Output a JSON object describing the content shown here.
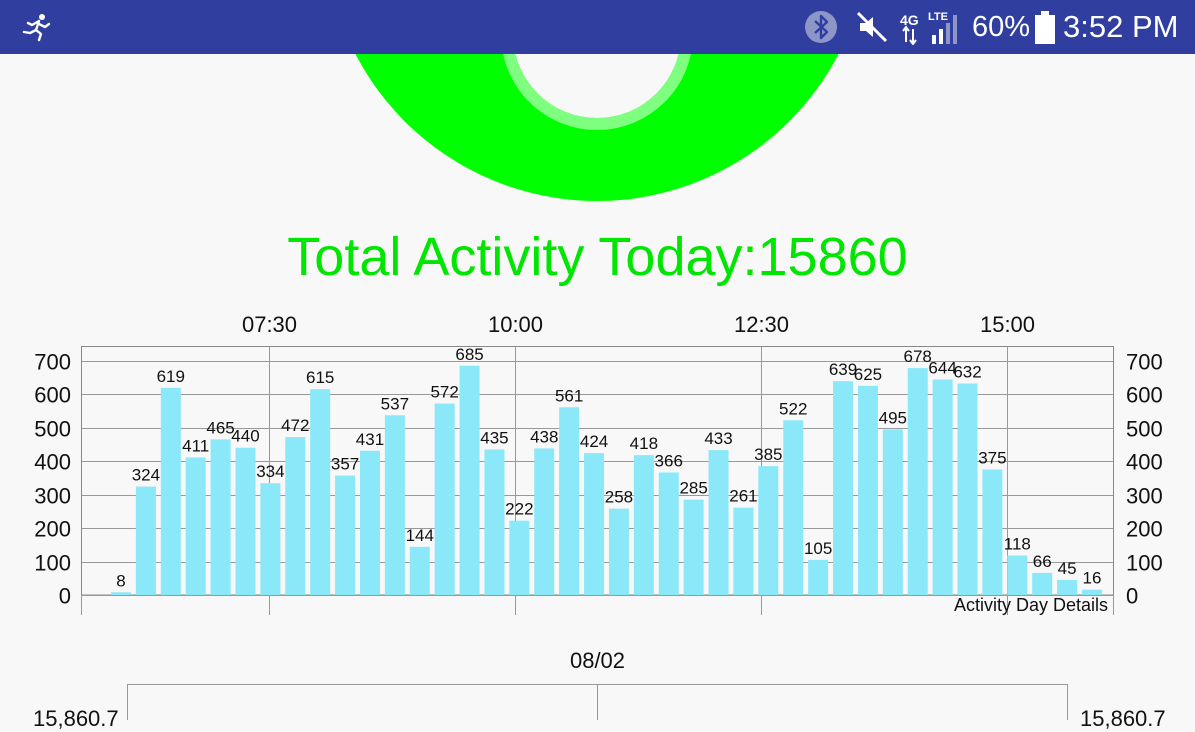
{
  "status_bar": {
    "battery_percent": "60%",
    "time": "3:52 PM",
    "network_label": "4G",
    "network_sub": "LTE",
    "colors": {
      "bar": "#303f9f"
    },
    "icons": [
      "running-person-icon",
      "bluetooth-icon",
      "mute-icon",
      "signal-icon",
      "battery-icon"
    ]
  },
  "activity_ring": {
    "color": "#00ff00"
  },
  "total_activity": {
    "label": "Total Activity Today:15860",
    "color": "#00e600"
  },
  "chart_data": {
    "type": "bar",
    "bar_color": "#8be8f8",
    "values": [
      8,
      324,
      619,
      411,
      465,
      440,
      334,
      472,
      615,
      357,
      431,
      537,
      144,
      572,
      685,
      435,
      222,
      438,
      561,
      424,
      258,
      418,
      366,
      285,
      433,
      261,
      385,
      522,
      105,
      639,
      625,
      495,
      678,
      644,
      632,
      375,
      118,
      66,
      45,
      16
    ],
    "x_tick_labels": [
      "07:30",
      "10:00",
      "12:30",
      "15:00"
    ],
    "y_ticks": [
      0,
      100,
      200,
      300,
      400,
      500,
      600,
      700
    ],
    "ylim": [
      0,
      750
    ],
    "grid": true,
    "description": "Activity Day Details"
  },
  "bottom_chart": {
    "date": "08/02",
    "left_axis_partial": "15,860.7",
    "right_axis_partial": "15,860.7"
  }
}
